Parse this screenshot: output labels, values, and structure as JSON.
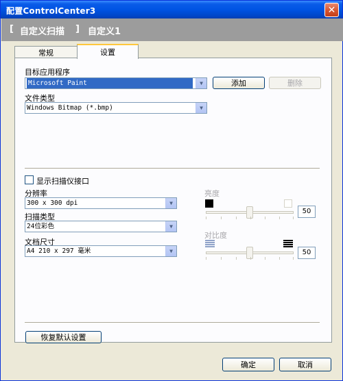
{
  "window": {
    "title": "配置ControlCenter3",
    "close_glyph": "✕"
  },
  "header": {
    "bracket_open": "[",
    "section": "自定义扫描",
    "bracket_close": "]",
    "name": "自定义1"
  },
  "tabs": [
    {
      "label": "常规",
      "active": false
    },
    {
      "label": "设置",
      "active": true
    }
  ],
  "target_app": {
    "label": "目标应用程序",
    "value": "Microsoft Paint",
    "add_label": "添加",
    "delete_label": "删除"
  },
  "file_type": {
    "label": "文件类型",
    "value": "Windows Bitmap (*.bmp)"
  },
  "show_scanner_ui": {
    "label": "显示扫描仪接口",
    "checked": false
  },
  "resolution": {
    "label": "分辨率",
    "value": "300 x 300 dpi"
  },
  "scan_type": {
    "label": "扫描类型",
    "value": "24位彩色"
  },
  "doc_size": {
    "label": "文档尺寸",
    "value": "A4 210 x 297 毫米"
  },
  "brightness": {
    "label": "亮度",
    "value": "50",
    "level": 0.5
  },
  "contrast": {
    "label": "对比度",
    "value": "50",
    "level": 0.5
  },
  "restore_defaults_label": "恢复默认设置",
  "ok_label": "确定",
  "cancel_label": "取消",
  "icons": {
    "dropdown": "chevron-down-icon",
    "brightness_low": "dark-square-icon",
    "brightness_high": "light-square-icon",
    "contrast_low": "low-contrast-icon",
    "contrast_high": "high-contrast-icon"
  },
  "colors": {
    "selection": "#316ac5",
    "titlebar": "#0054e3",
    "header_band": "#9c9c9c",
    "tab_highlight": "#ffc83c"
  }
}
